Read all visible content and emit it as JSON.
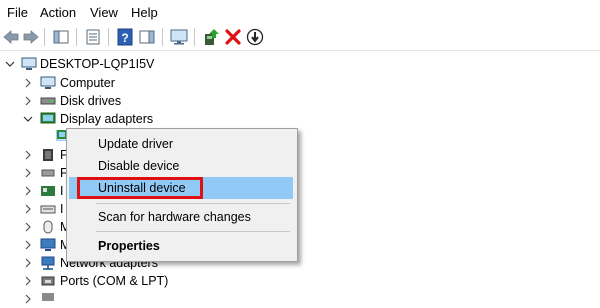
{
  "menu": [
    "File",
    "Action",
    "View",
    "Help"
  ],
  "tree": {
    "root": "DESKTOP-LQP1I5V",
    "items": [
      {
        "label": "Computer"
      },
      {
        "label": "Disk drives"
      },
      {
        "label": "Display adapters"
      },
      {
        "label": "Network adapters"
      },
      {
        "label": "Ports (COM & LPT)"
      }
    ],
    "partial_letters": [
      "F",
      "F",
      "I",
      "I",
      "M",
      "M"
    ]
  },
  "context_menu": {
    "items": [
      {
        "label": "Update driver"
      },
      {
        "label": "Disable device"
      },
      {
        "label": "Uninstall device"
      },
      {
        "label": "Scan for hardware changes"
      },
      {
        "label": "Properties"
      }
    ]
  },
  "colors": {
    "highlight": "#91c9f7",
    "annotation_box": "#e01010",
    "delete_icon": "#e01010"
  },
  "icons": [
    "back-icon",
    "forward-icon",
    "show-hide-console-tree-icon",
    "properties-icon",
    "help-icon",
    "action-pane-icon",
    "monitor-icon",
    "update-driver-icon",
    "uninstall-icon",
    "enable-device-icon"
  ]
}
